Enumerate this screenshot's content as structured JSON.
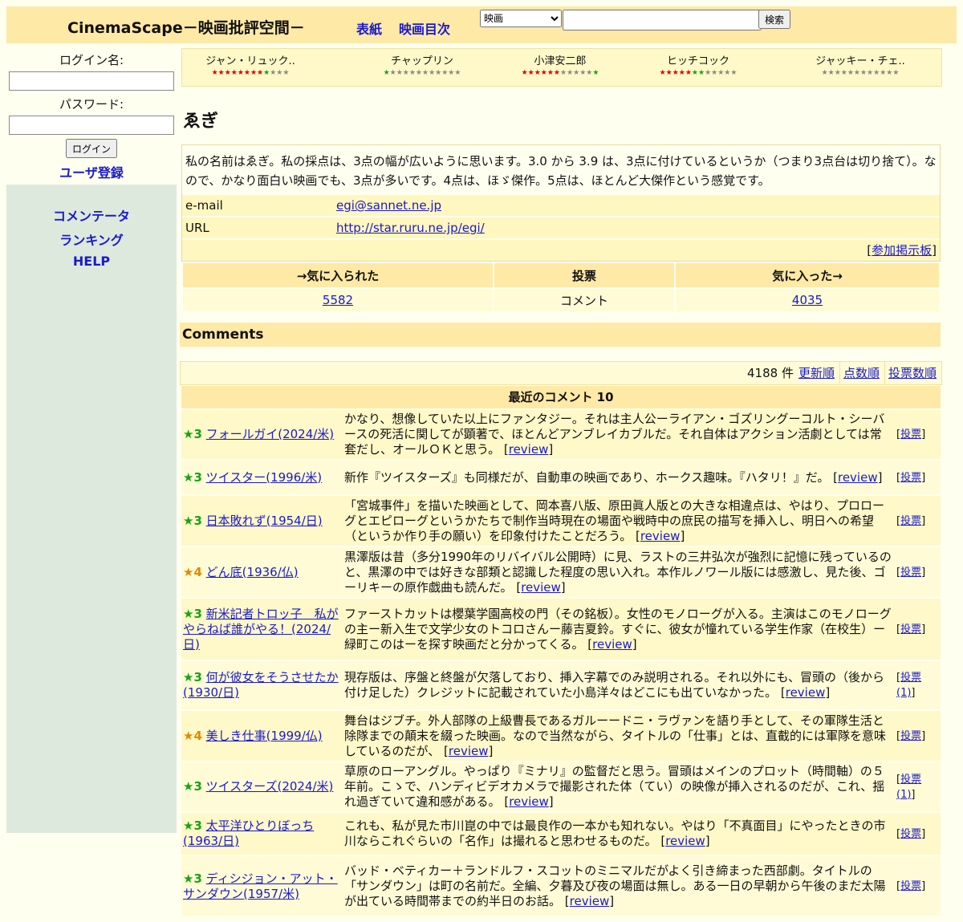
{
  "header": {
    "logo": "CinemaScape－映画批評空間－",
    "nav": [
      "表紙",
      "映画目次"
    ],
    "search_select": "映画",
    "search_button": "検索"
  },
  "sidebar": {
    "login_label": "ログイン名:",
    "password_label": "パスワード:",
    "login_button": "ログイン",
    "register": "ユーザ登録",
    "links": [
      "コメンテータ",
      "ランキング",
      "HELP"
    ]
  },
  "directors": [
    {
      "name": "ジャン・リュック..",
      "stars": "★★★★★★★★★★★★"
    },
    {
      "name": "チャップリン",
      "stars": "★★★★★★★★★★★★"
    },
    {
      "name": "小津安二郎",
      "stars": "★★★★★★★★★★★★"
    },
    {
      "name": "ヒッチコック",
      "stars": "★★★★★★★★★★★★"
    },
    {
      "name": "ジャッキー・チェ..",
      "stars": "★★★★★★★★★★★★"
    }
  ],
  "user": {
    "name": "ゑぎ",
    "description": "私の名前はゑぎ。私の採点は、3点の幅が広いように思います。3.0 から 3.9 は、3点に付けているというか（つまり3点台は切り捨て）。なので、かなり面白い映画でも、3点が多いです。4点は、ほゞ傑作。5点は、ほとんど大傑作という感覚です。",
    "email_label": "e-mail",
    "email": "egi@sannet.ne.jp",
    "url_label": "URL",
    "url": "http://star.ruru.ne.jp/egi/",
    "board": "参加掲示板"
  },
  "stats": {
    "headers": [
      "→気に入られた",
      "投票",
      "気に入った→"
    ],
    "values": [
      "5582",
      "コメント",
      "4035"
    ]
  },
  "comments_section": {
    "title": "Comments",
    "count": "4188 件",
    "sort_links": [
      "更新順",
      "点数順",
      "投票数順"
    ],
    "list_title": "最近のコメント 10",
    "items": [
      {
        "rating": "★3",
        "movie": "フォールガイ(2024/米)",
        "text": "かなり、想像していた以上にファンタジー。それは主人公ーライアン・ゴズリングーコルト・シーバースの死活に関してが顕著で、ほとんどアンブレイカブルだ。それ自体はアクション活劇としては常套だし、オールＯＫと思う。",
        "review": "review",
        "vote": "投票"
      },
      {
        "rating": "★3",
        "movie": "ツイスター(1996/米)",
        "text": "新作『ツイスターズ』も同様だが、自動車の映画であり、ホークス趣味。『ハタリ！』だ。",
        "review": "review",
        "vote": "投票"
      },
      {
        "rating": "★3",
        "movie": "日本敗れず(1954/日)",
        "text": "「宮城事件」を描いた映画として、岡本喜八版、原田眞人版との大きな相違点は、やはり、プロローグとエピローグというかたちで制作当時現在の場面や戦時中の庶民の描写を挿入し、明日への希望（というか作り手の願い）を印象付けたことだろう。",
        "review": "review",
        "vote": "投票"
      },
      {
        "rating": "★4",
        "movie": "どん底(1936/仏)",
        "text": "黒澤版は昔（多分1990年のリバイバル公開時）に見、ラストの三井弘次が強烈に記憶に残っているのと、黒澤の中では好きな部類と認識した程度の思い入れ。本作ルノワール版には感激し、見た後、ゴーリキーの原作戯曲も読んだ。",
        "review": "review",
        "vote": "投票"
      },
      {
        "rating": "★3",
        "movie": "新米記者トロッ子　私がやらねば誰がやる！(2024/日)",
        "text": "ファーストカットは櫻葉学園高校の門（その銘板）。女性のモノローグが入る。主演はこのモノローグの主ー新入生で文学少女のトコロさんー藤吉夏鈴。すぐに、彼女が憧れている学生作家（在校生）ー緑町このはーを探す映画だと分かってくる。",
        "review": "review",
        "vote": "投票"
      },
      {
        "rating": "★3",
        "movie": "何が彼女をそうさせたか(1930/日)",
        "text": "現存版は、序盤と終盤が欠落しており、挿入字幕でのみ説明される。それ以外にも、冒頭の（後から付け足した）クレジットに記載されていた小島洋々はどこにも出ていなかった。",
        "review": "review",
        "vote": "投票(1)"
      },
      {
        "rating": "★4",
        "movie": "美しき仕事(1999/仏)",
        "text": "舞台はジブチ。外人部隊の上級曹長であるガルーードニ・ラヴァンを語り手として、その軍隊生活と除隊までの顛末を綴った映画。なので当然ながら、タイトルの「仕事」とは、直截的には軍隊を意味しているのだが、",
        "review": "review",
        "vote": "投票"
      },
      {
        "rating": "★3",
        "movie": "ツイスターズ(2024/米)",
        "text": "草原のローアングル。やっぱり『ミナリ』の監督だと思う。冒頭はメインのプロット（時間軸）の５年前。こゝで、ハンディビデオカメラで撮影された体（てい）の映像が挿入されるのだが、これ、揺れ過ぎていて違和感がある。",
        "review": "review",
        "vote": "投票(1)"
      },
      {
        "rating": "★3",
        "movie": "太平洋ひとりぼっち(1963/日)",
        "text": "これも、私が見た市川崑の中では最良作の一本かも知れない。やはり「不真面目」にやったときの市川ならこれぐらいの「名作」は撮れると思わせるものだ。",
        "review": "review",
        "vote": "投票"
      },
      {
        "rating": "★3",
        "movie": "ディシジョン・アット・サンダウン(1957/米)",
        "text": "バッド・ベティカー＋ランドルフ・スコットのミニマルだがよく引き締まった西部劇。タイトルの「サンダウン」は町の名前だ。全編、夕暮及び夜の場面は無し。ある一日の早朝から午後のまだ太陽が出ている時間帯までの約半日のお話。",
        "review": "review",
        "vote": "投票"
      }
    ]
  },
  "colors": {
    "header_bg": "#ffe9a6",
    "sidebar_bg": "#dde9dd",
    "link": "#1a1acc",
    "star3": "#16a316",
    "star4": "#e08a00"
  }
}
